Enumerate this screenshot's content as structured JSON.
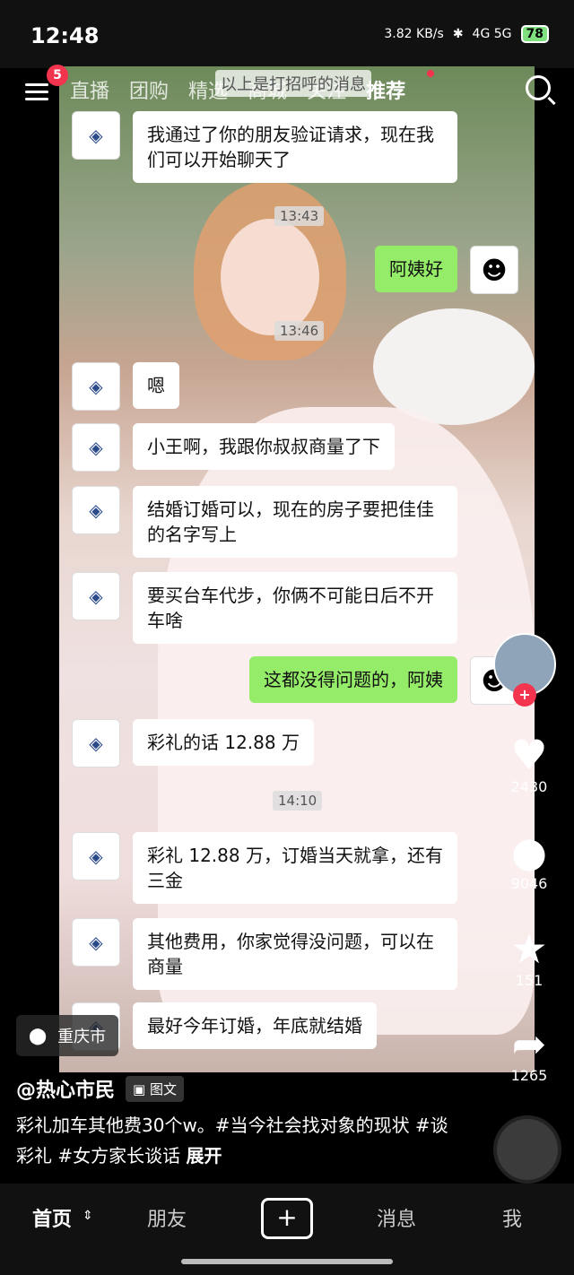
{
  "status": {
    "time": "12:48",
    "net_speed": "3.82 KB/s",
    "net_labels": "4G 5G",
    "battery": "78"
  },
  "nav": {
    "badge": "5",
    "tabs": [
      "直播",
      "团购",
      "精选",
      "商城",
      "关注",
      "推荐"
    ],
    "active_tab": "推荐",
    "overlay": "以上是打招呼的消息"
  },
  "chat": {
    "messages": [
      {
        "side": "left",
        "text": "我通过了你的朋友验证请求，现在我们可以开始聊天了"
      },
      {
        "side": "time",
        "text": "13:43"
      },
      {
        "side": "right",
        "text": "阿姨好"
      },
      {
        "side": "time",
        "text": "13:46"
      },
      {
        "side": "left",
        "text": "嗯"
      },
      {
        "side": "left",
        "text": "小王啊，我跟你叔叔商量了下"
      },
      {
        "side": "left",
        "text": "结婚订婚可以，现在的房子要把佳佳的名字写上"
      },
      {
        "side": "left",
        "text": "要买台车代步，你俩不可能日后不开车啥"
      },
      {
        "side": "right",
        "text": "这都没得问题的，阿姨"
      },
      {
        "side": "left",
        "text": "彩礼的话 12.88 万"
      },
      {
        "side": "time",
        "text": "14:10"
      },
      {
        "side": "left",
        "text": "彩礼 12.88 万，订婚当天就拿，还有三金"
      },
      {
        "side": "left",
        "text": "其他费用，你家觉得没问题，可以在商量"
      },
      {
        "side": "left",
        "text": "最好今年订婚，年底就结婚"
      }
    ]
  },
  "rail": {
    "likes": "2430",
    "comments": "9046",
    "favorites": "151",
    "shares": "1265"
  },
  "location": "重庆市",
  "author": {
    "name": "@热心市民",
    "tag": "图文"
  },
  "description": "彩礼加车其他费30个w。#当今社会找对象的现状 #谈彩礼 #女方家长谈话",
  "expand": "展开",
  "bottom_nav": {
    "home": "首页",
    "friends": "朋友",
    "messages": "消息",
    "me": "我"
  }
}
